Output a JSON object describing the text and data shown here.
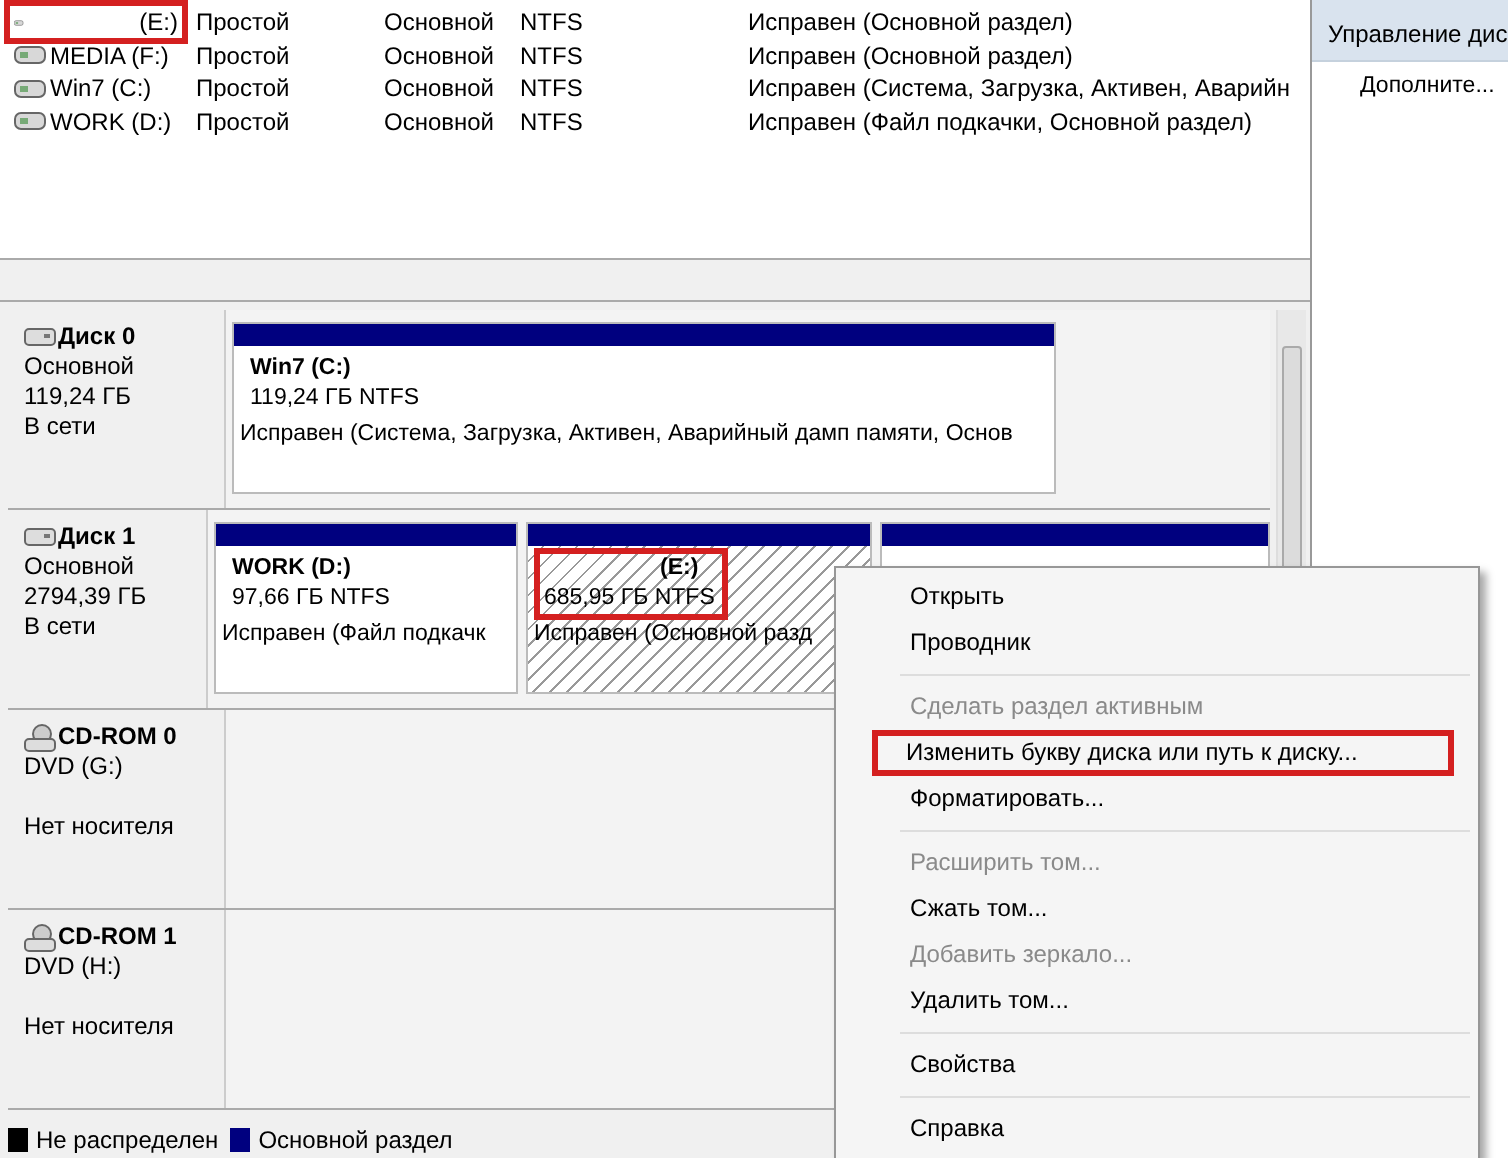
{
  "volumes": [
    {
      "name": "(E:)",
      "layout": "Простой",
      "type": "Основной",
      "fs": "NTFS",
      "status": "Исправен (Основной раздел)",
      "highlighted": true
    },
    {
      "name": "MEDIA (F:)",
      "layout": "Простой",
      "type": "Основной",
      "fs": "NTFS",
      "status": "Исправен (Основной раздел)",
      "highlighted": false
    },
    {
      "name": "Win7 (C:)",
      "layout": "Простой",
      "type": "Основной",
      "fs": "NTFS",
      "status": "Исправен (Система, Загрузка, Активен, Аварийн",
      "highlighted": false
    },
    {
      "name": "WORK (D:)",
      "layout": "Простой",
      "type": "Основной",
      "fs": "NTFS",
      "status": "Исправен (Файл подкачки, Основной раздел)",
      "highlighted": false
    }
  ],
  "actions": {
    "title": "Управление дис",
    "items": [
      "Дополните..."
    ]
  },
  "disks": [
    {
      "kind": "disk",
      "name": "Диск 0",
      "type": "Основной",
      "size": "119,24 ГБ",
      "status": "В сети",
      "partitions": [
        {
          "title": "Win7  (C:)",
          "size": "119,24 ГБ NTFS",
          "status": "Исправен (Система, Загрузка, Активен, Аварийный дамп памяти, Основ",
          "selected": false,
          "highlighted": false
        }
      ]
    },
    {
      "kind": "disk",
      "name": "Диск 1",
      "type": "Основной",
      "size": "2794,39 ГБ",
      "status": "В сети",
      "partitions": [
        {
          "title": "WORK  (D:)",
          "size": "97,66 ГБ NTFS",
          "status": "Исправен (Файл подкачк",
          "selected": false,
          "highlighted": false
        },
        {
          "title": "(E:)",
          "size": "685,95 ГБ NTFS",
          "status": "Исправен (Основной разд",
          "selected": true,
          "highlighted": true
        },
        {
          "selected": false
        }
      ]
    },
    {
      "kind": "cdrom",
      "name": "CD-ROM 0",
      "type": "DVD (G:)",
      "status": "Нет носителя"
    },
    {
      "kind": "cdrom",
      "name": "CD-ROM 1",
      "type": "DVD (H:)",
      "status": "Нет носителя"
    }
  ],
  "legend": [
    {
      "label": "Не распределен",
      "color": "#000000"
    },
    {
      "label": "Основной раздел",
      "color": "#00007f"
    }
  ],
  "context_menu": [
    [
      {
        "label": "Открыть",
        "disabled": false,
        "highlighted": false
      },
      {
        "label": "Проводник",
        "disabled": false,
        "highlighted": false
      }
    ],
    [
      {
        "label": "Сделать раздел активным",
        "disabled": true,
        "highlighted": false
      },
      {
        "label": "Изменить букву диска или путь к диску...",
        "disabled": false,
        "highlighted": true
      },
      {
        "label": "Форматировать...",
        "disabled": false,
        "highlighted": false
      }
    ],
    [
      {
        "label": "Расширить том...",
        "disabled": true,
        "highlighted": false
      },
      {
        "label": "Сжать том...",
        "disabled": false,
        "highlighted": false
      },
      {
        "label": "Добавить зеркало...",
        "disabled": true,
        "highlighted": false
      },
      {
        "label": "Удалить том...",
        "disabled": false,
        "highlighted": false
      }
    ],
    [
      {
        "label": "Свойства",
        "disabled": false,
        "highlighted": false
      }
    ],
    [
      {
        "label": "Справка",
        "disabled": false,
        "highlighted": false
      }
    ]
  ]
}
